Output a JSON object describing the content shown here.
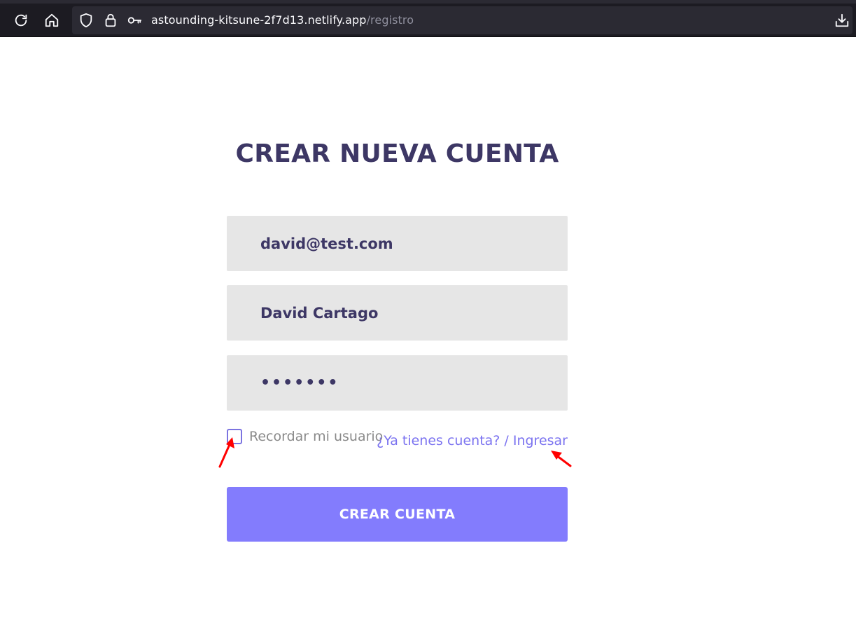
{
  "browser": {
    "url_host": "astounding-kitsune-2f7d13.netlify.app",
    "url_path": "/registro",
    "icons": [
      "reload-icon",
      "home-icon",
      "shield-icon",
      "lock-icon",
      "key-icon",
      "download-icon"
    ]
  },
  "page": {
    "title": "CREAR NUEVA CUENTA",
    "email_value": "david@test.com",
    "name_value": "David Cartago",
    "password_value": "•••••••",
    "remember_label": "Recordar mi usuario",
    "login_link": "¿Ya tienes cuenta? / Ingresar",
    "submit_label": "CREAR CUENTA"
  },
  "colors": {
    "title": "#3d3765",
    "link": "#7b73f0",
    "button": "#837cfd",
    "annotation_arrow": "#ff0000"
  }
}
